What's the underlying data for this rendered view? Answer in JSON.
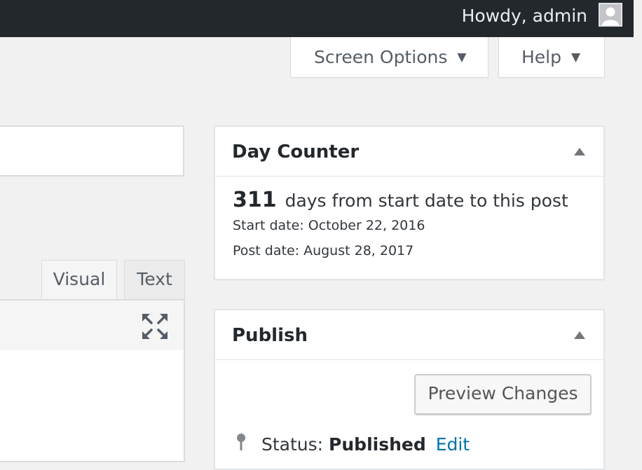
{
  "admin_bar": {
    "greeting": "Howdy, admin",
    "avatar_icon": "user-avatar-icon",
    "background_color": "#23282d"
  },
  "screen_meta": {
    "screen_options_label": "Screen Options",
    "help_label": "Help",
    "caret_icon": "caret-down-icon"
  },
  "editor": {
    "tabs": [
      {
        "label": "Visual",
        "active": true
      },
      {
        "label": "Text",
        "active": false
      }
    ],
    "fullscreen_icon": "fullscreen-expand-icon"
  },
  "day_counter": {
    "title": "Day Counter",
    "days": "311",
    "summary_text": "days from start date to this post",
    "start_date": "Start date: October 22, 2016",
    "post_date": "Post date: August 28, 2017",
    "toggle_icon": "collapse-arrow-icon"
  },
  "publish": {
    "title": "Publish",
    "preview_label": "Preview Changes",
    "status_label": "Status:",
    "status_value": "Published",
    "status_edit": "Edit",
    "status_icon": "pin-icon",
    "toggle_icon": "collapse-arrow-icon",
    "link_color": "#0073aa"
  }
}
